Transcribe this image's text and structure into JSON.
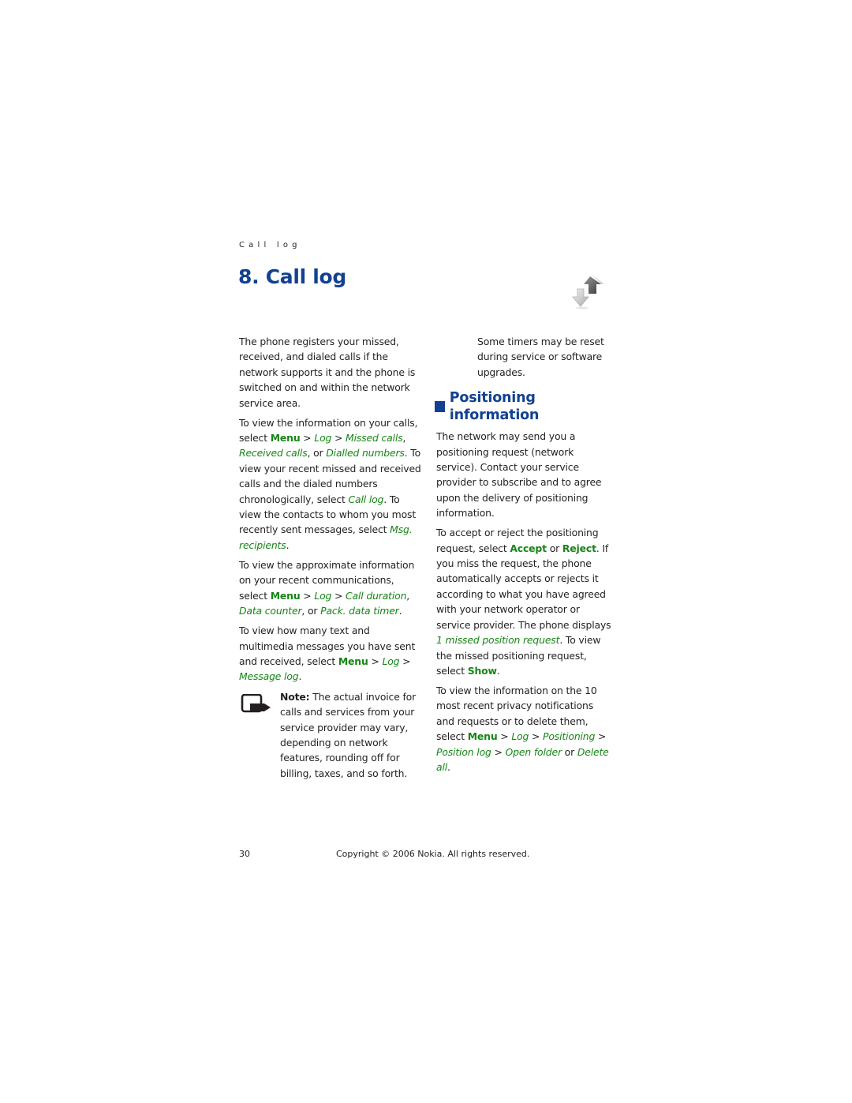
{
  "running_head": "Call log",
  "chapter": {
    "title": "8. Call log",
    "icon": "call-log-arrows-icon"
  },
  "left_column": {
    "p1": "The phone registers your missed, received, and dialed calls if the network supports it and the phone is switched on and within the network service area.",
    "p2": {
      "t1": "To view the information on your calls, select ",
      "menu": "Menu",
      "sep1": " > ",
      "log": "Log",
      "sep2": " > ",
      "missed": "Missed calls",
      "comma1": ", ",
      "received": "Received calls",
      "or1": ", or ",
      "dialled": "Dialled numbers",
      "t2": ". To view your recent missed and received calls and the dialed numbers chronologically, select ",
      "call_log": "Call log",
      "t3": ". To view the contacts to whom you most recently sent messages, select ",
      "msg_recipients": "Msg. recipients",
      "t4": "."
    },
    "p3": {
      "t1": "To view the approximate information on your recent communications, select ",
      "menu": "Menu",
      "sep1": " > ",
      "log": "Log",
      "sep2": " > ",
      "call_duration": "Call duration",
      "comma1": ", ",
      "data_counter": "Data counter",
      "or1": ", or ",
      "pack_data_timer": "Pack. data timer",
      "t2": "."
    },
    "p4": {
      "t1": "To view how many text and multimedia messages you have sent and received, select ",
      "menu": "Menu",
      "sep1": " > ",
      "log": "Log",
      "sep2": " > ",
      "message_log": "Message log",
      "t2": "."
    },
    "note": {
      "icon": "note-hand-icon",
      "label": "Note:",
      "text": " The actual invoice for calls and services from your service provider may vary, depending on network features, rounding off for billing, taxes, and so forth."
    }
  },
  "right_column": {
    "note_continued": "Some timers may be reset during service or software upgrades.",
    "section_title": "Positioning information",
    "p1": "The network may send you a positioning request (network service). Contact your service provider to subscribe and to agree upon the delivery of positioning information.",
    "p2": {
      "t1": "To accept or reject the positioning request, select ",
      "accept": "Accept",
      "or1": " or ",
      "reject": "Reject",
      "t2": ". If you miss the request, the phone automatically accepts or rejects it according to what you have agreed with your network operator or service provider. The phone displays ",
      "missed_request": "1 missed position request",
      "t3": ". To view the missed positioning request, select ",
      "show": "Show",
      "t4": "."
    },
    "p3": {
      "t1": "To view the information on the 10 most recent privacy notifications and requests or to delete them, select ",
      "menu": "Menu",
      "sep1": " > ",
      "log": "Log",
      "sep2": " > ",
      "positioning": "Positioning",
      "sep3": " > ",
      "position_log": "Position log",
      "sep4": " > ",
      "open_folder": "Open folder",
      "or1": " or ",
      "delete_all": "Delete all",
      "t2": "."
    }
  },
  "footer": {
    "page_number": "30",
    "copyright": "Copyright © 2006 Nokia. All rights reserved."
  },
  "colors": {
    "heading_blue": "#124191",
    "menu_green": "#168516",
    "text": "#231f20"
  }
}
